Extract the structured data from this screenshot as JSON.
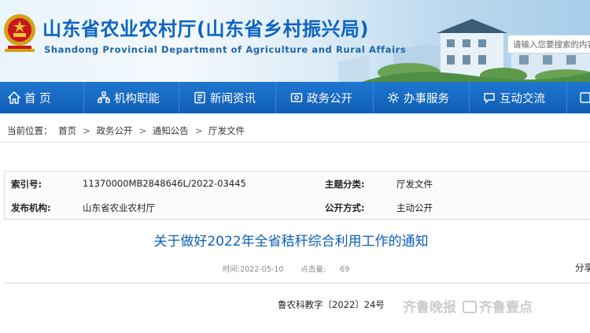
{
  "header": {
    "title": "山东省农业农村厅(山东省乡村振兴局)",
    "subtitle": "Shandong Provincial Department of Agriculture and Rural Affairs",
    "search_placeholder": "请输入您要搜索的内容"
  },
  "nav": {
    "items": [
      {
        "label": "首 页",
        "icon": "home-icon"
      },
      {
        "label": "机构职能",
        "icon": "org-icon"
      },
      {
        "label": "新闻资讯",
        "icon": "news-icon"
      },
      {
        "label": "政务公开",
        "icon": "public-icon"
      },
      {
        "label": "办事服务",
        "icon": "service-icon"
      },
      {
        "label": "互动交流",
        "icon": "chat-icon"
      }
    ]
  },
  "breadcrumb": {
    "prefix": "当前位置：",
    "items": [
      "首页",
      "政务公开",
      "通知公告",
      "厅发文件"
    ]
  },
  "info": {
    "index_key": "索引号:",
    "index_value": "11370000MB2848646L/2022-03445",
    "topic_key": "主题分类:",
    "topic_value": "厅发文件",
    "issuer_key": "发布机构:",
    "issuer_value": "山东省农业农村厅",
    "mode_key": "公开方式:",
    "mode_value": "主动公开"
  },
  "article": {
    "title": "关于做好2022年全省秸秆综合利用工作的通知",
    "time_label": "时间:",
    "time_value": "2022-05-10",
    "hits_label": "点击量:",
    "hits_value": "69",
    "share_label": "分享",
    "doc_number": "鲁农科教字〔2022〕24号"
  },
  "watermark": {
    "left_text": "齐鲁晚报",
    "right_text": "齐鲁壹点"
  },
  "colors": {
    "nav_blue": "#1565c0",
    "title_blue": "#0c5fb8"
  }
}
